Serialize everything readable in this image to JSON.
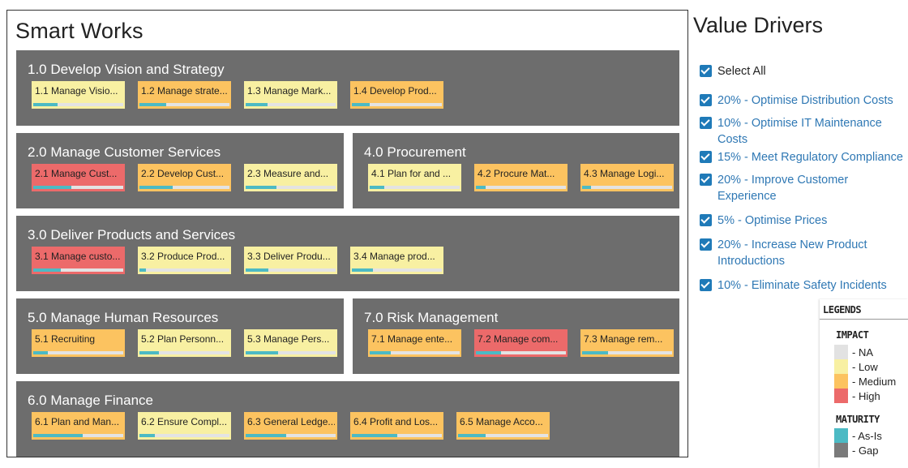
{
  "title": "Smart Works",
  "groups": [
    {
      "title": "1.0 Develop Vision and Strategy",
      "cards": [
        {
          "label": "1.1 Manage Visio...",
          "impact": "low",
          "maturity": 0.27
        },
        {
          "label": "1.2 Manage strate...",
          "impact": "medium",
          "maturity": 0.3
        },
        {
          "label": "1.3 Manage Mark...",
          "impact": "low",
          "maturity": 0.24
        },
        {
          "label": "1.4 Develop Prod...",
          "impact": "medium",
          "maturity": 0.2
        }
      ]
    },
    {
      "title": "2.0 Manage Customer Services",
      "cards": [
        {
          "label": "2.1 Manage Cust...",
          "impact": "high",
          "maturity": 0.42
        },
        {
          "label": "2.2 Develop Cust...",
          "impact": "medium",
          "maturity": 0.37
        },
        {
          "label": "2.3 Measure and...",
          "impact": "low",
          "maturity": 0.34
        }
      ]
    },
    {
      "title": "4.0 Procurement",
      "cards": [
        {
          "label": "4.1 Plan for and ...",
          "impact": "low",
          "maturity": 0.16
        },
        {
          "label": "4.2 Procure Mat...",
          "impact": "medium",
          "maturity": 0.11
        },
        {
          "label": "4.3 Manage Logi...",
          "impact": "medium",
          "maturity": 0.1
        }
      ]
    },
    {
      "title": "3.0 Deliver Products and Services",
      "cards": [
        {
          "label": "3.1 Manage custo...",
          "impact": "high",
          "maturity": 0.31
        },
        {
          "label": "3.2 Produce Prod...",
          "impact": "low",
          "maturity": 0.07
        },
        {
          "label": "3.3 Deliver Produ...",
          "impact": "low",
          "maturity": 0.25
        },
        {
          "label": "3.4 Manage prod...",
          "impact": "low",
          "maturity": 0.23
        }
      ]
    },
    {
      "title": "5.0 Manage Human Resources",
      "cards": [
        {
          "label": "5.1 Recruiting",
          "impact": "medium",
          "maturity": 0.16
        },
        {
          "label": "5.2 Plan Personn...",
          "impact": "low",
          "maturity": 0.22
        },
        {
          "label": "5.3 Manage Pers...",
          "impact": "low",
          "maturity": 0.36
        }
      ]
    },
    {
      "title": "7.0 Risk Management",
      "cards": [
        {
          "label": "7.1 Manage ente...",
          "impact": "medium",
          "maturity": 0.23
        },
        {
          "label": "7.2 Manage com...",
          "impact": "high",
          "maturity": 0.28
        },
        {
          "label": "7.3 Manage rem...",
          "impact": "medium",
          "maturity": 0.29
        }
      ]
    },
    {
      "title": "6.0 Manage Finance",
      "cards": [
        {
          "label": "6.1 Plan and Man...",
          "impact": "medium",
          "maturity": 0.55
        },
        {
          "label": "6.2 Ensure Compl...",
          "impact": "low",
          "maturity": 0.17
        },
        {
          "label": "6.3 General Ledge...",
          "impact": "medium",
          "maturity": 0.45
        },
        {
          "label": "6.4 Profit and Los...",
          "impact": "medium",
          "maturity": 0.5
        },
        {
          "label": "6.5 Manage Acco...",
          "impact": "medium",
          "maturity": 0.31
        }
      ]
    }
  ],
  "value_drivers": {
    "title": "Value Drivers",
    "select_all": "Select All",
    "items": [
      "20% - Optimise Distribution Costs",
      "10% - Optimise IT Maintenance Costs",
      "15% - Meet Regulatory Compliance",
      "20% - Improve Customer Experience",
      "5% - Optimise Prices",
      "20% - Increase New Product Introductions",
      "10% - Eliminate Safety Incidents"
    ]
  },
  "legend": {
    "title": "LEGENDS",
    "impact_title": "IMPACT",
    "impact": [
      {
        "label": "- NA",
        "color": "#e2e2e2"
      },
      {
        "label": "- Low",
        "color": "#f8f0a2"
      },
      {
        "label": "- Medium",
        "color": "#fcc360"
      },
      {
        "label": "- High",
        "color": "#ec6a6a"
      }
    ],
    "maturity_title": "MATURITY",
    "maturity": [
      {
        "label": "- As-Is",
        "color": "#4cbac4"
      },
      {
        "label": "- Gap",
        "color": "#7a7a7a"
      }
    ]
  }
}
